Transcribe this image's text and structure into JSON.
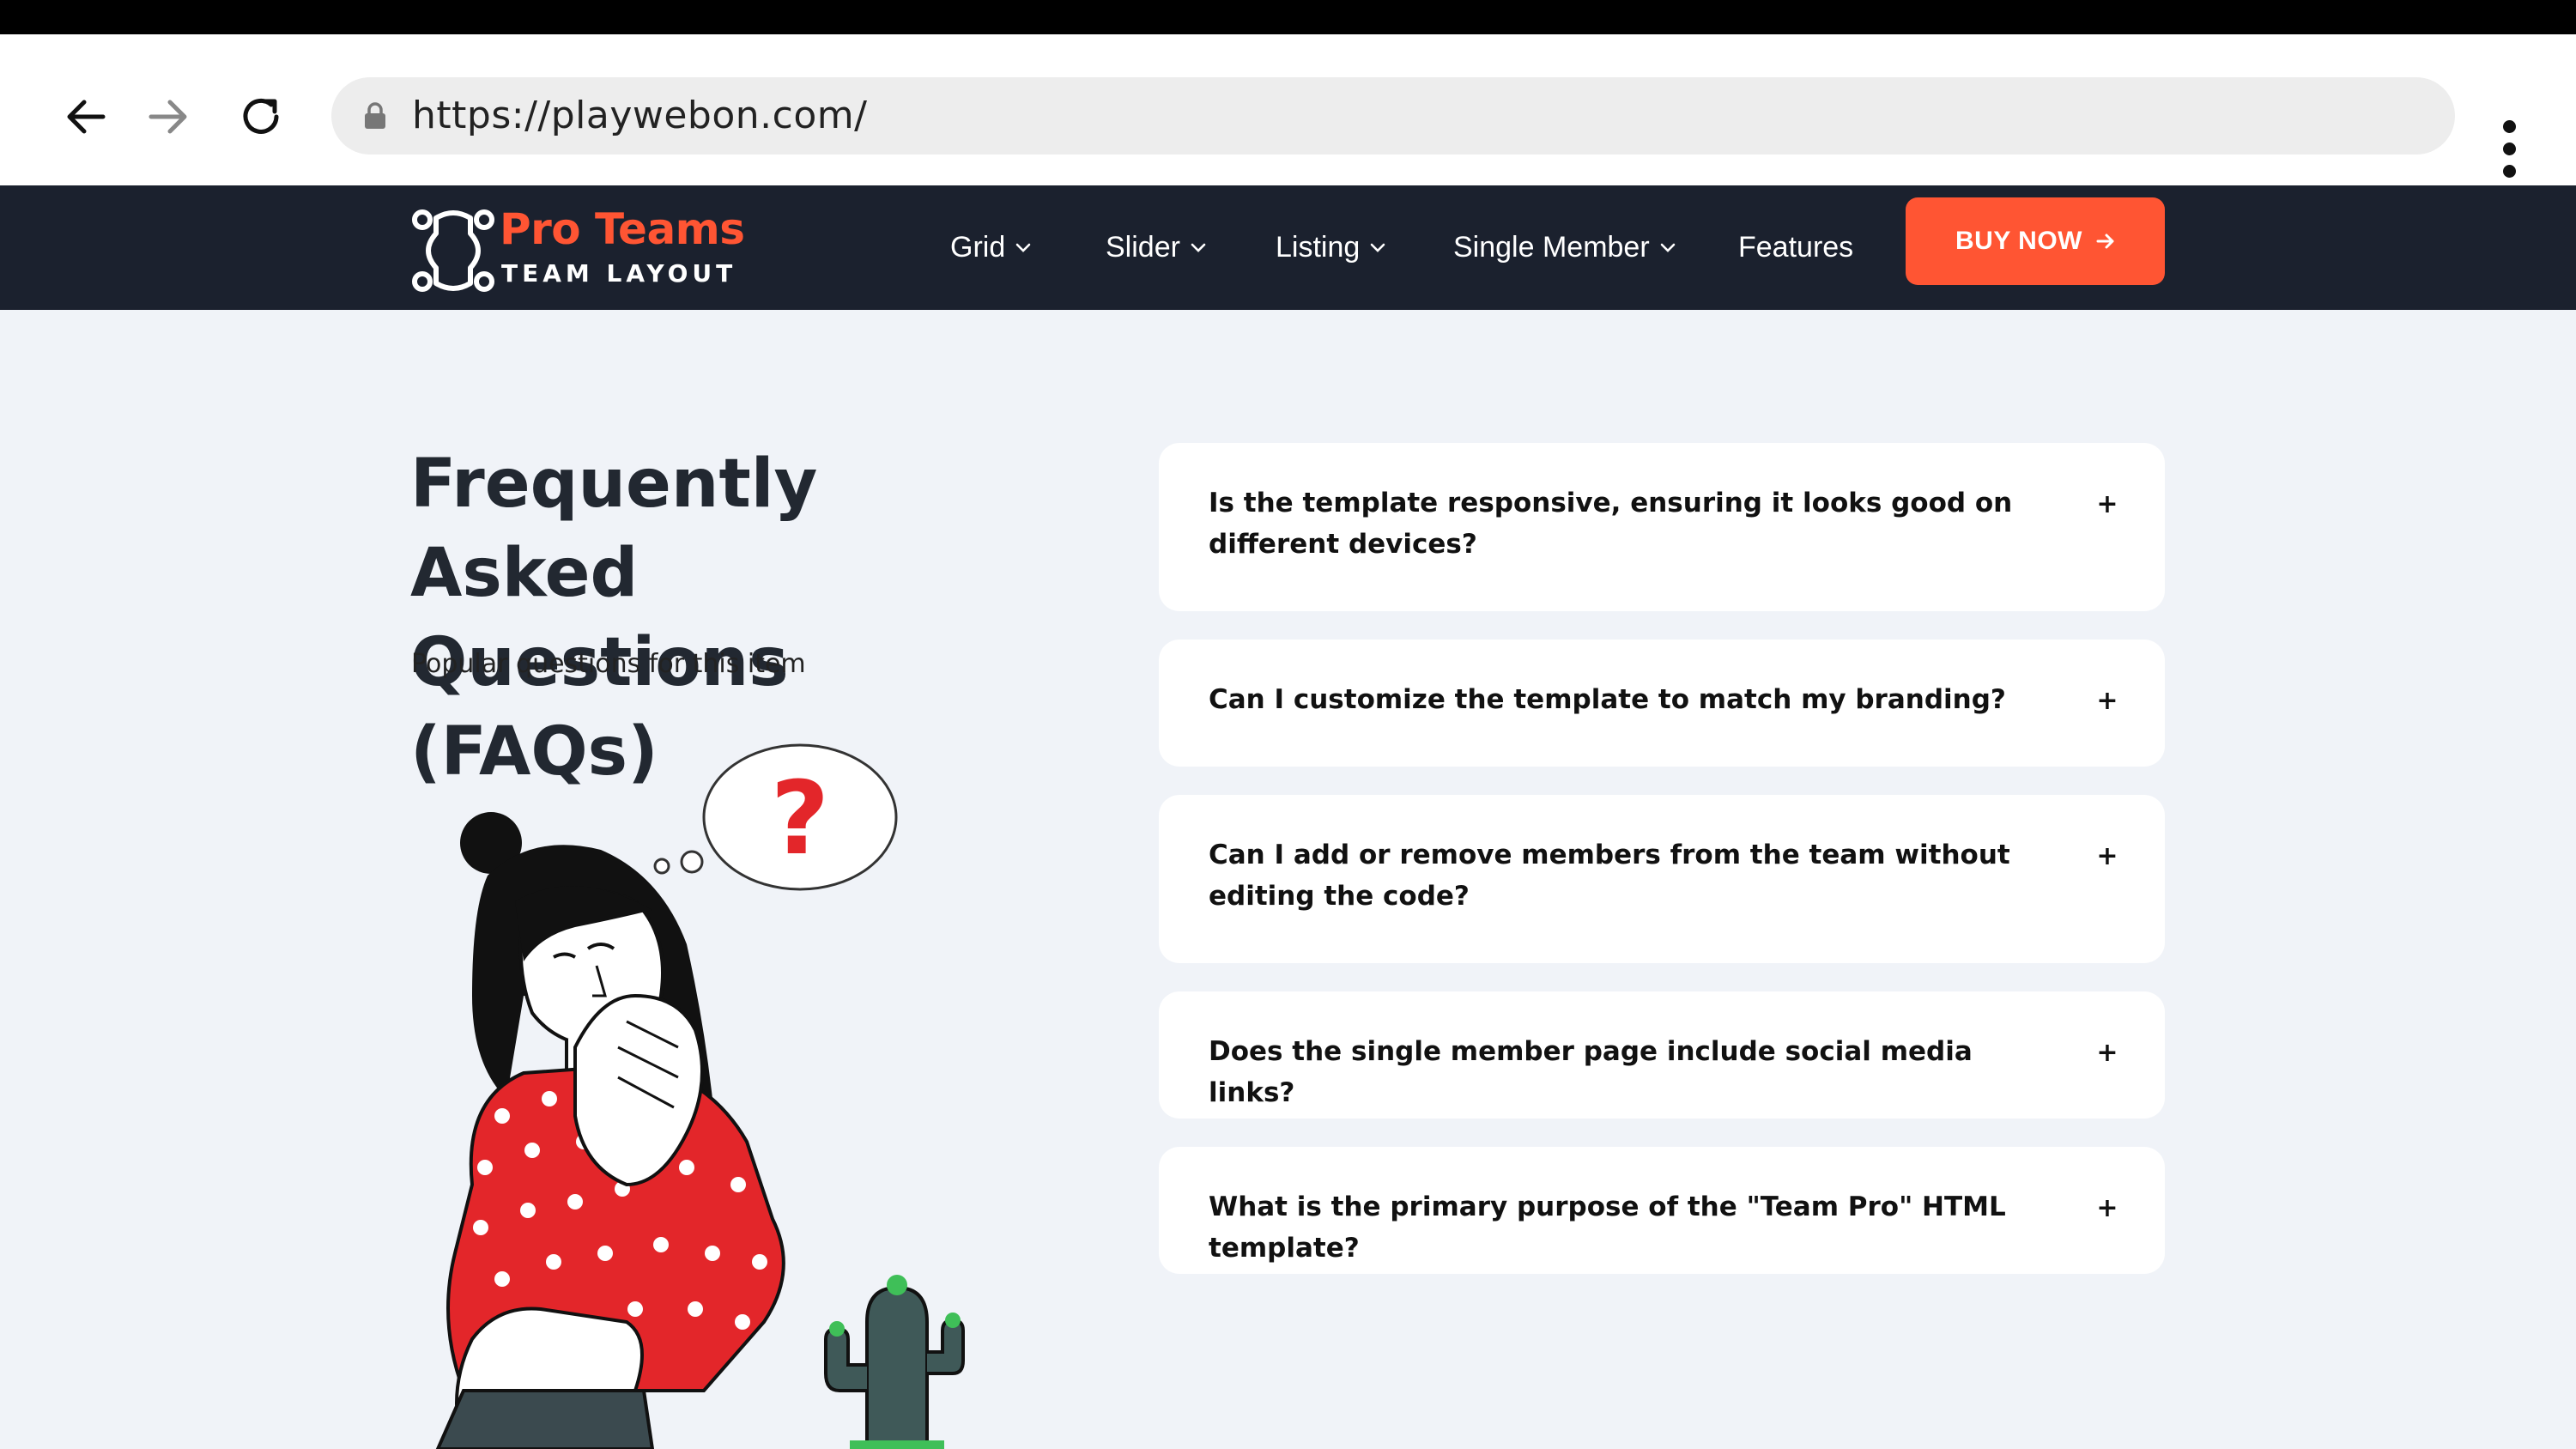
{
  "browser": {
    "url": "https://playwebon.com/",
    "back_icon": "arrow-left-icon",
    "forward_icon": "arrow-right-icon",
    "reload_icon": "reload-icon",
    "lock_icon": "lock-icon",
    "menu_icon": "more-vertical-icon"
  },
  "header": {
    "logo_title": "Pro Teams",
    "logo_subtitle": "TEAM LAYOUT",
    "nav": [
      {
        "label": "Grid",
        "dropdown": true
      },
      {
        "label": "Slider",
        "dropdown": true
      },
      {
        "label": "Listing",
        "dropdown": true
      },
      {
        "label": "Single Member",
        "dropdown": true
      },
      {
        "label": "Features",
        "dropdown": false
      }
    ],
    "buy_label": "BUY NOW"
  },
  "faq": {
    "title_line1": "Frequently Asked",
    "title_line2": "Questions (FAQs)",
    "subtitle": "Popular questions for this item",
    "toggle_symbol": "+",
    "items": [
      {
        "question": "Is the template responsive, ensuring it looks good on different devices?"
      },
      {
        "question": "Can I customize the template to match my branding?"
      },
      {
        "question": "Can I add or remove members from the team without editing the code?"
      },
      {
        "question": "Does the single member page include social media links?"
      },
      {
        "question": "What is the primary purpose of the \"Team Pro\" HTML template?"
      }
    ]
  },
  "colors": {
    "accent": "#ff5533",
    "header_bg": "#1b212e",
    "page_bg": "#f0f3f8"
  }
}
